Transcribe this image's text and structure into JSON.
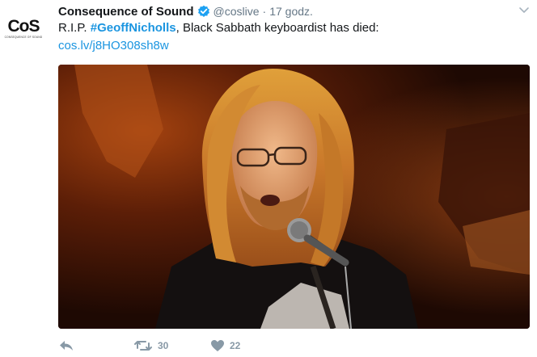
{
  "account": {
    "avatar_text": "CoS",
    "avatar_subtext": "CONSEQUENCE OF SOUND",
    "name": "Consequence of Sound",
    "handle": "@coslive",
    "separator": "·",
    "time": "17 godz."
  },
  "tweet": {
    "text_prefix": "R.I.P. ",
    "hashtag": "#GeoffNicholls",
    "text_suffix": ", Black Sabbath keyboardist has died:",
    "link": "cos.lv/j8HO308sh8w"
  },
  "icons": {
    "verified": "verified-badge-icon",
    "caret": "chevron-down-icon",
    "reply": "reply-icon",
    "retweet": "retweet-icon",
    "like": "heart-icon"
  },
  "actions": {
    "retweets": "30",
    "likes": "22"
  },
  "colors": {
    "link": "#1b95e0",
    "muted": "#657786",
    "action_icon": "#8899a6",
    "verified": "#1da1f2"
  }
}
